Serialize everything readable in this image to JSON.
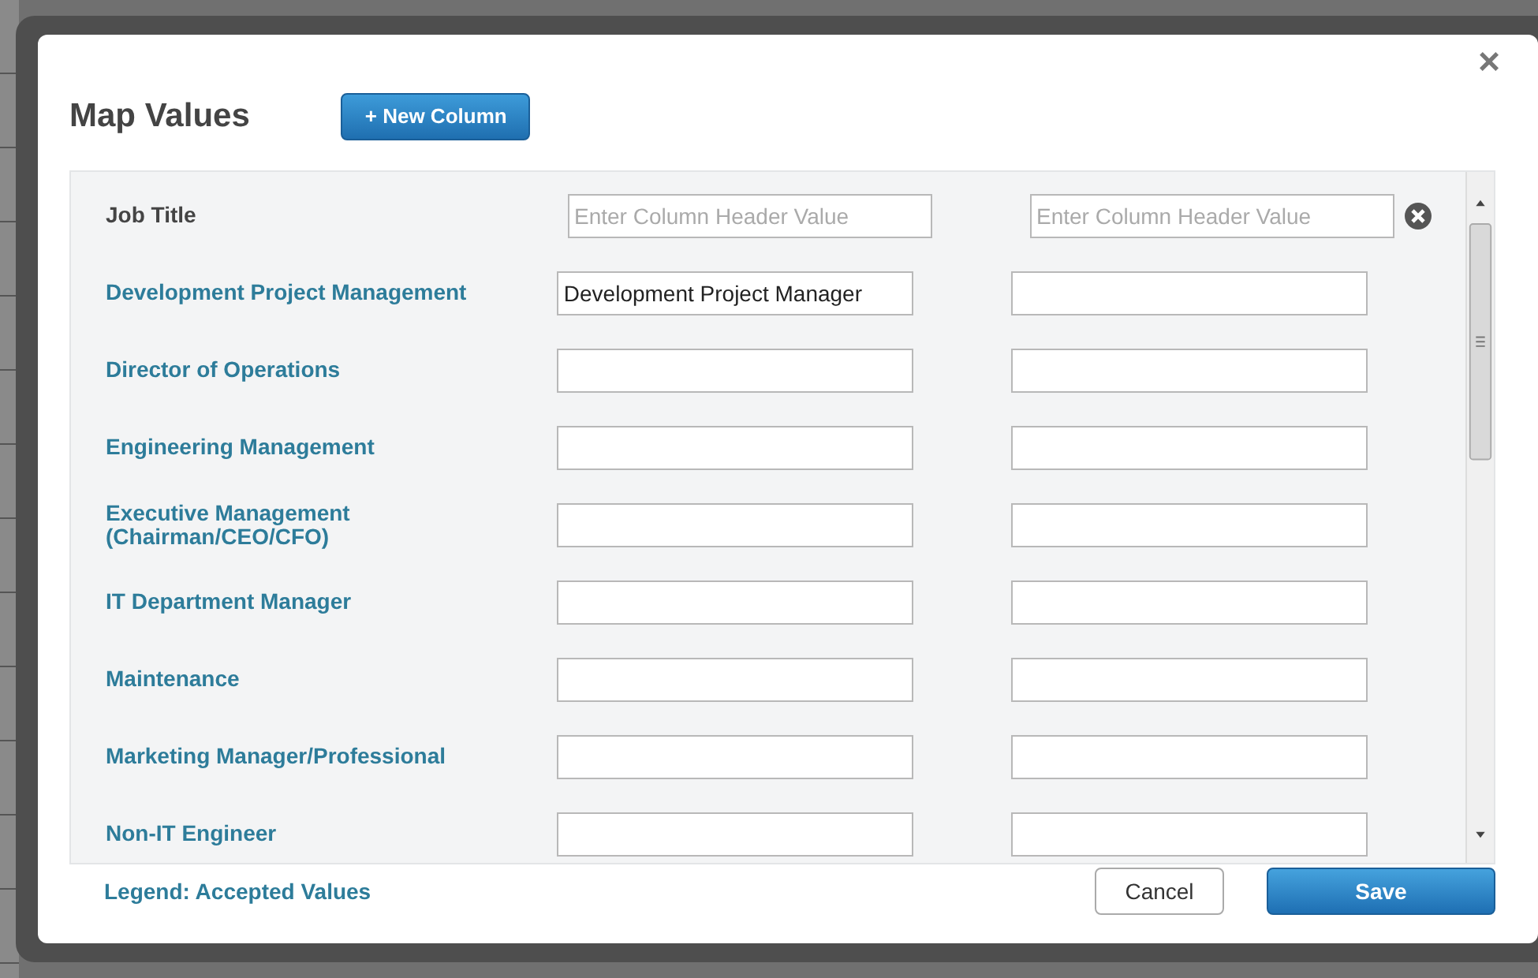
{
  "dialog": {
    "title": "Map Values",
    "new_column_button": "+ New Column",
    "close": "×",
    "header_row": {
      "label": "Job Title",
      "placeholders": [
        "Enter Column Header Value",
        "Enter Column Header Value"
      ]
    },
    "rows": [
      {
        "label": "Development Project Management",
        "values": [
          "Development Project Manager"
        ]
      },
      {
        "label": "Director of Operations"
      },
      {
        "label": "Engineering Management"
      },
      {
        "label": "Executive Management (Chairman/CEO/CFO)"
      },
      {
        "label": "IT Department Manager"
      },
      {
        "label": "Maintenance"
      },
      {
        "label": "Marketing Manager/Professional"
      },
      {
        "label": "Non-IT Engineer"
      }
    ],
    "legend_link": "Legend: Accepted Values",
    "buttons": [
      {
        "label": "Cancel",
        "kind": "secondary"
      },
      {
        "label": "Save",
        "kind": "primary"
      }
    ]
  }
}
